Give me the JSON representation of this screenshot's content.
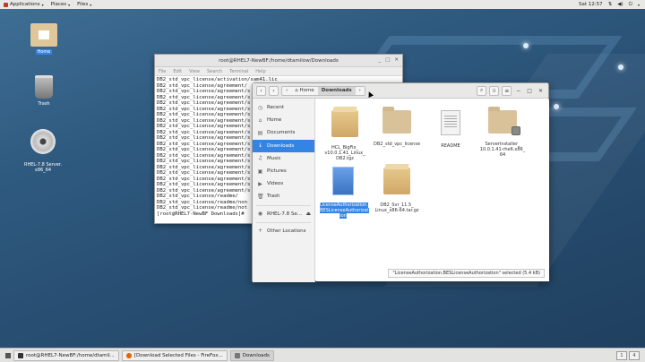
{
  "topbar": {
    "applications": "Applications",
    "places": "Places",
    "files": "Files",
    "clock": "Sat 12:57"
  },
  "desktop": {
    "icons": [
      {
        "label": "Home"
      },
      {
        "label": "Trash"
      },
      {
        "label": "RHEL-7.8 Server.\nx86_64"
      }
    ]
  },
  "terminal": {
    "title": "root@RHEL7-NewBF:/home/dtamilow/Downloads",
    "menu": [
      "File",
      "Edit",
      "View",
      "Search",
      "Terminal",
      "Help"
    ],
    "lines": [
      "DB2_std_vpc_license/activation/sam41.lic",
      "DB2_std_vpc_license/agreement/",
      "DB2_std_vpc_license/agreement/s",
      "DB2_std_vpc_license/agreement/s",
      "DB2_std_vpc_license/agreement/s",
      "DB2_std_vpc_license/agreement/s",
      "DB2_std_vpc_license/agreement/s",
      "DB2_std_vpc_license/agreement/s",
      "DB2_std_vpc_license/agreement/s",
      "DB2_std_vpc_license/agreement/s",
      "DB2_std_vpc_license/agreement/s",
      "DB2_std_vpc_license/agreement/s",
      "DB2_std_vpc_license/agreement/s",
      "DB2_std_vpc_license/agreement/s",
      "DB2_std_vpc_license/agreement/s",
      "DB2_std_vpc_license/agreement/s",
      "DB2_std_vpc_license/agreement/s",
      "DB2_std_vpc_license/agreement/s",
      "DB2_std_vpc_license/agreement/s",
      "DB2_std_vpc_license/agreement/s",
      "DB2_std_vpc_license/readme/",
      "DB2_std_vpc_license/readme/non",
      "DB2_std_vpc_license/readme/not",
      "[root@RHEL7-NewBF Downloads]# "
    ]
  },
  "filemanager": {
    "path": {
      "home": "Home",
      "current": "Downloads"
    },
    "sidebar": [
      {
        "icon": "clock-icon",
        "glyph": "◷",
        "label": "Recent"
      },
      {
        "icon": "home-icon",
        "glyph": "⌂",
        "label": "Home"
      },
      {
        "icon": "documents-icon",
        "glyph": "▤",
        "label": "Documents"
      },
      {
        "icon": "downloads-icon",
        "glyph": "↓",
        "label": "Downloads"
      },
      {
        "icon": "music-icon",
        "glyph": "♫",
        "label": "Music"
      },
      {
        "icon": "pictures-icon",
        "glyph": "▣",
        "label": "Pictures"
      },
      {
        "icon": "videos-icon",
        "glyph": "▶",
        "label": "Videos"
      },
      {
        "icon": "trash-icon",
        "glyph": "🗑",
        "label": "Trash"
      },
      {
        "icon": "disc-icon",
        "glyph": "◉",
        "label": "RHEL-7.8 Se..."
      },
      {
        "icon": "plus-icon",
        "glyph": "+",
        "label": "Other Locations"
      }
    ],
    "files": [
      {
        "label": "HCL_BigFix_\nv10.0.1.41_Linux_\nDB2.tgz"
      },
      {
        "label": "DB2_std_vpc_license"
      },
      {
        "label": "README"
      },
      {
        "label": "ServerInstaller_\n10.0.1.41-rhe6.x86_\n64"
      },
      {
        "label": "LicenseAuthorization.\nBESLicenseAuthorizat\nion"
      },
      {
        "label": "DB2_Svr_11.5_\nLinux_x86-64.tar.gz"
      }
    ],
    "status": "\"LicenseAuthorization.BESLicenseAuthorization\" selected (5.4 kB)"
  },
  "taskbar": {
    "tasks": [
      {
        "label": "root@RHEL7-NewBF:/home/dtamil..."
      },
      {
        "label": "[Download Selected Files - FireFox..."
      },
      {
        "label": "Downloads"
      }
    ],
    "pager": [
      "1",
      "4"
    ]
  }
}
